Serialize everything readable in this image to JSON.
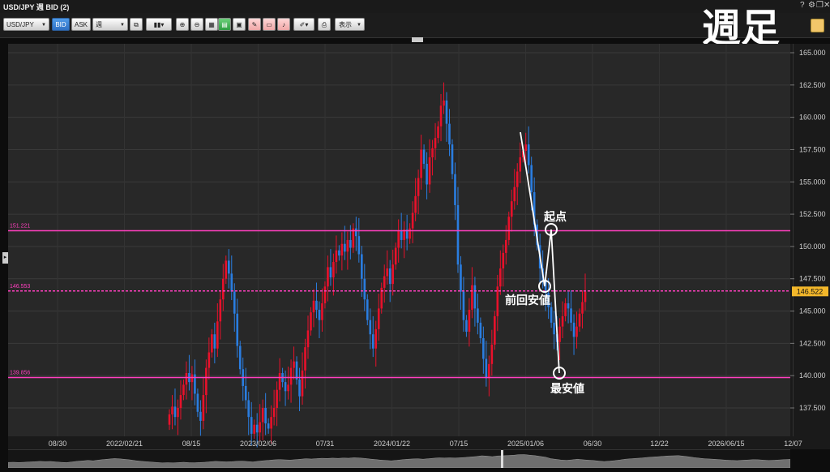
{
  "window": {
    "title": "USD/JPY 週 BID (2)",
    "controls": [
      "?",
      "⚙",
      "❐",
      "✕"
    ]
  },
  "toolbar": {
    "symbol": "USD/JPY",
    "bid_label": "BID",
    "ask_label": "ASK",
    "period": "週",
    "display_label": "表示",
    "buttons": [
      "chart-type-icon",
      "zoom-in-icon",
      "zoom-out-icon",
      "grid-icon",
      "compare-icon",
      "window-icon",
      "draw-line-icon",
      "draw-rect-icon",
      "draw-fib-icon",
      "pen-icon",
      "screenshot-icon"
    ]
  },
  "stamp": "週足",
  "chart_data": {
    "type": "candlestick",
    "y_ticks": [
      "165.000",
      "162.500",
      "160.000",
      "157.500",
      "155.000",
      "152.500",
      "150.000",
      "147.500",
      "145.000",
      "142.500",
      "140.000",
      "137.500"
    ],
    "x_ticks": [
      "08/30",
      "2022/02/21",
      "08/15",
      "2023/02/06",
      "07/31",
      "2024/01/22",
      "07/15",
      "2025/01/06",
      "06/30",
      "12/22",
      "2026/06/15",
      "12/07"
    ],
    "ylim": [
      136.0,
      166.0
    ],
    "current_price": "146.522",
    "hlines": [
      {
        "value": 151.221,
        "label": "151.221",
        "color": "#ff3fbf"
      },
      {
        "value": 146.553,
        "label": "146.553",
        "color": "#ff3fbf",
        "dashed": true
      },
      {
        "value": 139.856,
        "label": "139.856",
        "color": "#ff3fbf"
      }
    ],
    "annotations": [
      {
        "text": "起点",
        "price": 151.2
      },
      {
        "text": "前回安値",
        "price": 146.8
      },
      {
        "text": "最安値",
        "price": 140.2
      }
    ],
    "up_color": "#e8112b",
    "down_color": "#2a7de0",
    "closes": [
      137,
      137.6,
      136.8,
      137.5,
      138.5,
      139.3,
      140.2,
      139.5,
      140.1,
      138.6,
      137.2,
      136.5,
      138.5,
      140.6,
      141.8,
      143.2,
      142.1,
      144.2,
      145.9,
      147.5,
      148.9,
      147.9,
      146.5,
      144.8,
      142.3,
      140.5,
      139.2,
      138.1,
      136.8,
      135.5,
      136.2,
      135.6,
      136.4,
      137.5,
      136.3,
      135.9,
      136.8,
      137.5,
      138.9,
      140.2,
      139.5,
      138.8,
      139.3,
      140.6,
      141.1,
      139.7,
      138.4,
      140.4,
      142.2,
      143.5,
      144.9,
      145.8,
      145.1,
      144.3,
      145.6,
      146.9,
      148.4,
      147.6,
      148.8,
      149.7,
      149.3,
      150.2,
      149.6,
      150.5,
      149.9,
      151.4,
      150.8,
      149.4,
      147.5,
      145.9,
      144.3,
      143.2,
      142.1,
      143.6,
      145.2,
      146.8,
      147.7,
      148.3,
      147.1,
      148.6,
      149.9,
      151.2,
      150.5,
      151.3,
      150.6,
      151.4,
      152.6,
      153.9,
      155.3,
      157.5,
      156.4,
      154.8,
      156.9,
      157.6,
      158.4,
      159.3,
      160.9,
      161.3,
      159.5,
      157.9,
      155.6,
      153.2,
      148.6,
      146.5,
      144.3,
      143.4,
      145.1,
      147.0,
      145.2,
      144.1,
      142.9,
      141.3,
      139.8,
      140.9,
      142.4,
      144.6,
      146.9,
      148.3,
      149.5,
      150.5,
      152.3,
      153.5,
      154.6,
      155.8,
      156.9,
      157.4,
      157.9,
      156.3,
      154.2,
      151.7,
      150.1,
      148.3,
      147.4,
      146.4,
      145.3,
      144.1,
      143.2,
      142.6,
      143.8,
      144.6,
      145.6,
      145.2,
      144.1,
      143.0,
      143.8,
      144.8,
      145.7,
      146.5
    ]
  },
  "chart_labels": {
    "hline_a": "151.221",
    "hline_b": "146.553",
    "hline_c": "139.856"
  }
}
